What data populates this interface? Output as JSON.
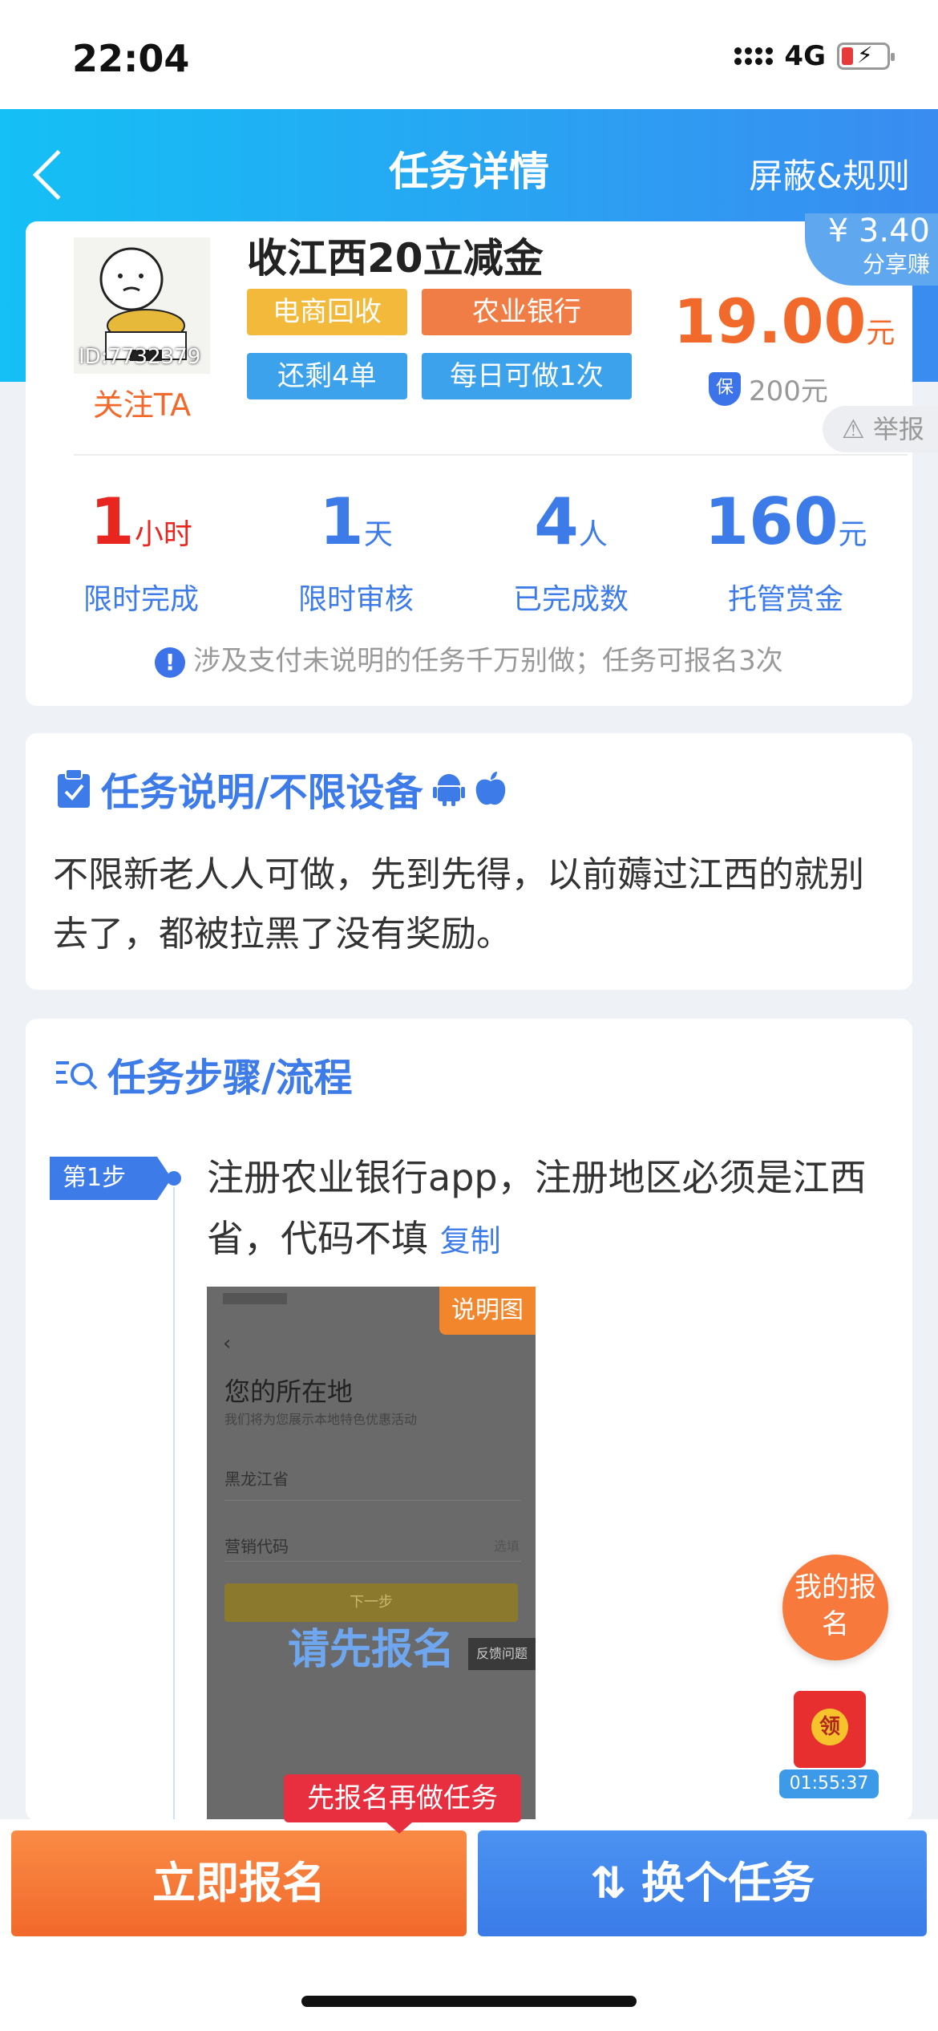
{
  "status_bar": {
    "time": "22:04",
    "network": "4G"
  },
  "header": {
    "title": "任务详情",
    "right_action": "屏蔽&规则"
  },
  "task": {
    "avatar_id": "ID:7732379",
    "follow_label": "关注TA",
    "title": "收江西20立减金",
    "tags": [
      "电商回收",
      "农业银行",
      "还剩4单",
      "每日可做1次"
    ],
    "price": "19.00",
    "price_unit": "元",
    "deposit": "200元",
    "share_amount": "¥ 3.40",
    "share_label": "分享赚",
    "report_label": "举报"
  },
  "stats": [
    {
      "value": "1",
      "unit": "小时",
      "label": "限时完成",
      "color": "#e8261f"
    },
    {
      "value": "1",
      "unit": "天",
      "label": "限时审核",
      "color": "#3d7be8"
    },
    {
      "value": "4",
      "unit": "人",
      "label": "已完成数",
      "color": "#3d7be8"
    },
    {
      "value": "160",
      "unit": "元",
      "label": "托管赏金",
      "color": "#3d7be8"
    }
  ],
  "notice": "涉及支付未说明的任务千万别做；任务可报名3次",
  "description": {
    "title": "任务说明/不限设备",
    "text": "不限新老人人可做，先到先得，以前薅过江西的就别去了，都被拉黑了没有奖励。"
  },
  "steps": {
    "title": "任务步骤/流程",
    "items": [
      {
        "badge": "第1步",
        "text": "注册农业银行app，注册地区必须是江西省，代码不填",
        "copy_label": "复制",
        "image_label": "说明图",
        "image_overlay": "请先报名",
        "image_texts": {
          "heading": "您的所在地",
          "hint": "我们将为您展示本地特色优惠活动",
          "province": "黑龙江省",
          "code": "营销代码",
          "code_hint": "选填",
          "next": "下一步",
          "feedback": "反馈问题"
        }
      }
    ]
  },
  "floating": {
    "my_signup": "我的报名",
    "redpack_badge": "领",
    "timer": "01:55:37"
  },
  "tip": "先报名再做任务",
  "actions": {
    "signup": "立即报名",
    "switch": "换个任务"
  },
  "colors": {
    "brand_blue": "#3d7be8",
    "orange": "#f2692c",
    "red": "#e8261f"
  }
}
